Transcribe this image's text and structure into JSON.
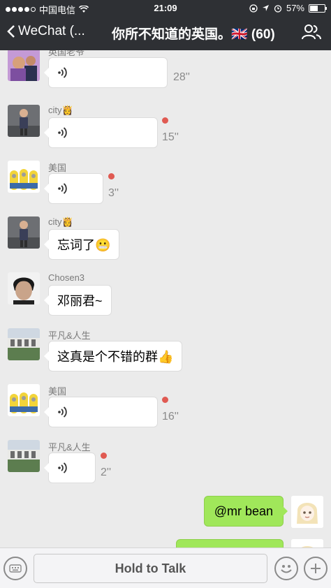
{
  "status_bar": {
    "carrier": "中国电信",
    "time": "21:09",
    "battery": "57%",
    "battery_level": 0.57
  },
  "nav": {
    "back_label": "WeChat (...",
    "title": "你所不知道的英国。🇬🇧 (60)"
  },
  "messages": [
    {
      "sender": "英国老爷",
      "type": "voice",
      "duration": "28''",
      "unread": false
    },
    {
      "sender": "city👸",
      "type": "voice",
      "duration": "15''",
      "unread": true
    },
    {
      "sender": "美国",
      "type": "voice",
      "duration": "3''",
      "unread": true
    },
    {
      "sender": "city👸",
      "type": "text",
      "text": "忘词了😬"
    },
    {
      "sender": "Chosen3",
      "type": "text",
      "text": "邓丽君~"
    },
    {
      "sender": "平凡&人生",
      "type": "text",
      "text": "这真是个不错的群👍"
    },
    {
      "sender": "美国",
      "type": "voice",
      "duration": "16''",
      "unread": true
    },
    {
      "sender": "平凡&人生",
      "type": "voice",
      "duration": "2''",
      "unread": true
    }
  ],
  "my_messages": [
    {
      "text": "@mr bean"
    },
    {
      "text": ""
    }
  ],
  "toolbar": {
    "hold_to_talk": "Hold to Talk"
  }
}
